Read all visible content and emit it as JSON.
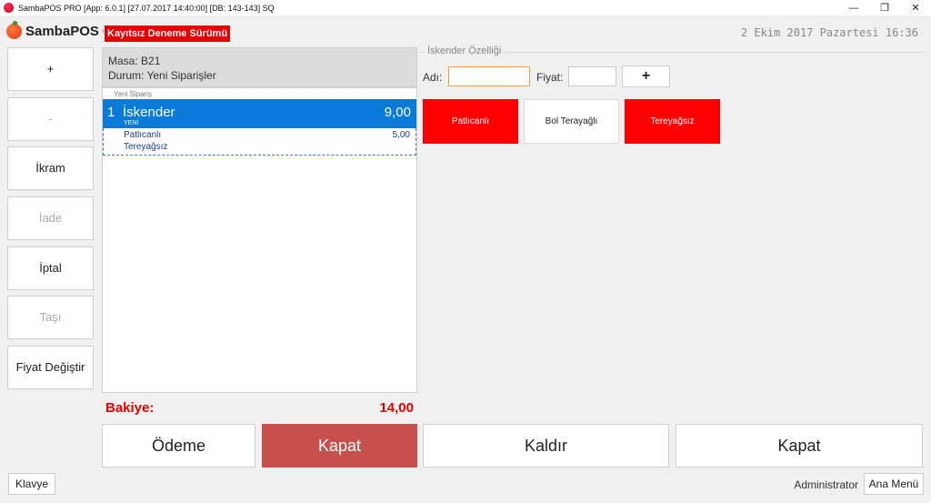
{
  "window": {
    "title": "SambaPOS PRO [App: 6.0.1] [27.07.2017 14:40:00] [DB: 143-143] SQ",
    "minimize": "—",
    "restore": "❐",
    "close": "✕"
  },
  "header": {
    "brand": "SambaPOS 6",
    "trial_badge": "Kayıtsız Deneme Sürümü",
    "datetime": "2 Ekim 2017 Pazartesi 16:36"
  },
  "left_actions": [
    {
      "label": "+",
      "enabled": true
    },
    {
      "label": "-",
      "enabled": false
    },
    {
      "label": "İkram",
      "enabled": true
    },
    {
      "label": "İade",
      "enabled": false
    },
    {
      "label": "İptal",
      "enabled": true
    },
    {
      "label": "Taşı",
      "enabled": false
    },
    {
      "label": "Fiyat Değiştir",
      "enabled": true
    }
  ],
  "ticket": {
    "table": "Masa: B21",
    "status": "Durum: Yeni Siparişler",
    "group_label": "Yeni Sipariş",
    "order": {
      "qty": "1",
      "name": "İskender",
      "price": "9,00",
      "state": "YENİ",
      "tags": [
        {
          "name": "Patlıcanlı",
          "price": "5,00"
        },
        {
          "name": "Tereyağsız",
          "price": ""
        }
      ]
    },
    "balance_label": "Bakiye:",
    "balance_value": "14,00"
  },
  "properties": {
    "title": "İskender Özelliği",
    "name_label": "Adı:",
    "name_value": "",
    "price_label": "Fiyat:",
    "price_value": "",
    "add_label": "+",
    "tags": [
      {
        "label": "Patlıcanlı",
        "selected": true
      },
      {
        "label": "Bol Terayağlı",
        "selected": false
      },
      {
        "label": "Tereyağsız",
        "selected": true
      }
    ]
  },
  "bottom_buttons": {
    "payment": "Ödeme",
    "close_red": "Kapat",
    "remove": "Kaldır",
    "close": "Kapat"
  },
  "footer": {
    "keyboard": "Klavye",
    "user": "Administrator",
    "main_menu": "Ana Menü"
  },
  "colors": {
    "accent_blue": "#0a7ad8",
    "alert_red": "#e60000",
    "tag_red": "#ff0000",
    "close_button_red": "#c8504c"
  }
}
